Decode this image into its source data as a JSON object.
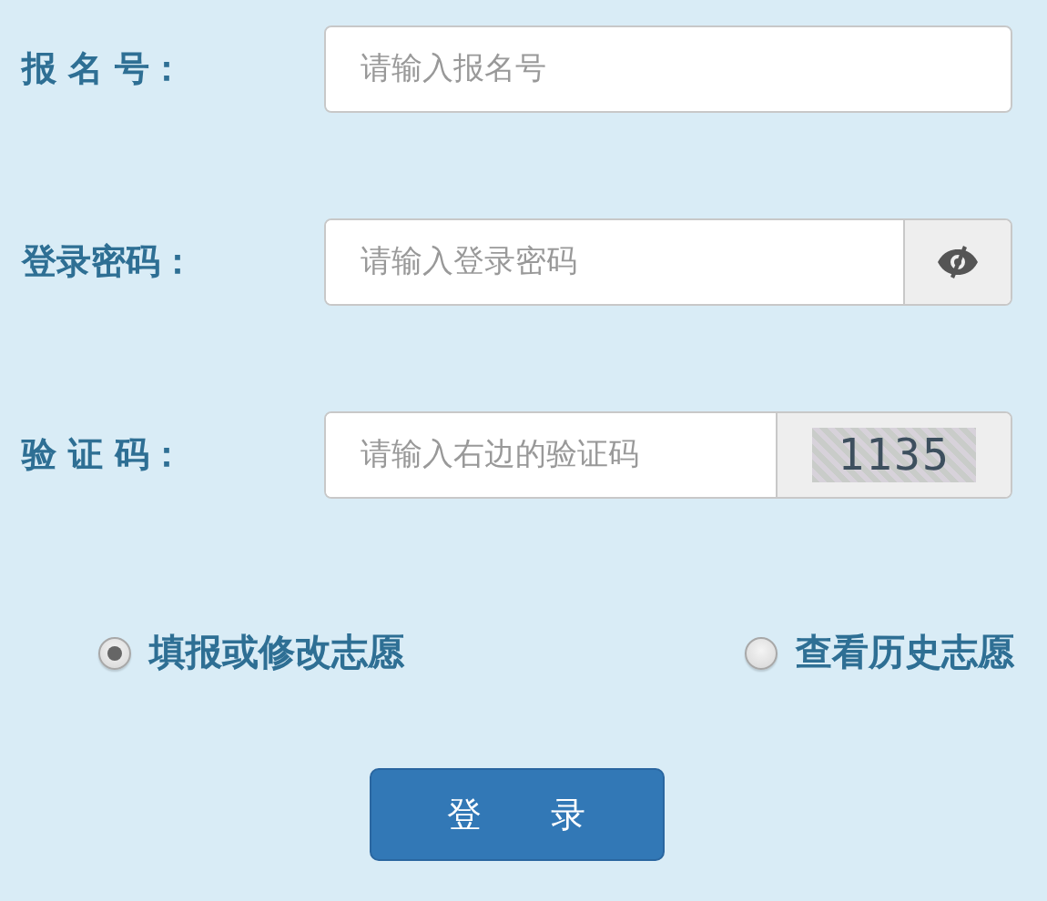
{
  "fields": [
    {
      "kind": "text",
      "label": "报 名 号：",
      "placeholder": "请输入报名号"
    },
    {
      "kind": "password",
      "label": "登录密码：",
      "placeholder": "请输入登录密码"
    },
    {
      "kind": "captcha",
      "label": "验 证 码：",
      "placeholder": "请输入右边的验证码",
      "captcha": "1135"
    }
  ],
  "options": [
    {
      "label": "填报或修改志愿",
      "selected": true
    },
    {
      "label": "查看历史志愿",
      "selected": false
    }
  ],
  "submit": "登　　录"
}
